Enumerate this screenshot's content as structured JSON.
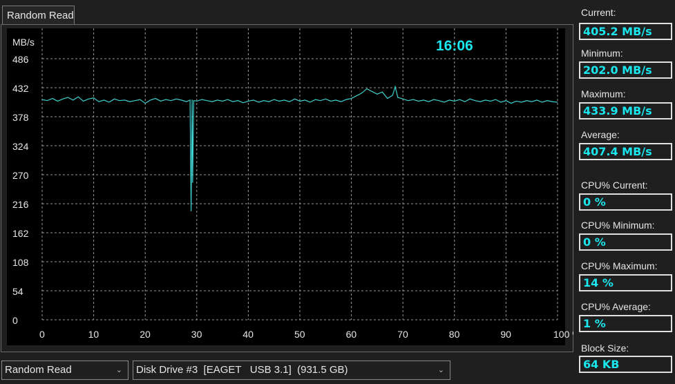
{
  "tab": {
    "label": "Random Read"
  },
  "clock": "16:06",
  "stats": [
    {
      "label": "Current:",
      "value": "405.2 MB/s"
    },
    {
      "label": "Minimum:",
      "value": "202.0 MB/s"
    },
    {
      "label": "Maximum:",
      "value": "433.9 MB/s"
    },
    {
      "label": "Average:",
      "value": "407.4 MB/s"
    },
    {
      "label": "CPU% Current:",
      "value": "0 %"
    },
    {
      "label": "CPU% Minimum:",
      "value": "0 %"
    },
    {
      "label": "CPU% Maximum:",
      "value": "14 %"
    },
    {
      "label": "CPU% Average:",
      "value": "1 %"
    },
    {
      "label": "Block Size:",
      "value": "64 KB"
    }
  ],
  "controls": {
    "test_select": "Random Read",
    "drive_select": "Disk Drive #3  [EAGET   USB 3.1]  (931.5 GB)"
  },
  "chart_data": {
    "type": "line",
    "ylabel": "MB/s",
    "xlabel": "%",
    "yticks": [
      "486",
      "432",
      "378",
      "324",
      "270",
      "216",
      "162",
      "108",
      "54",
      "0"
    ],
    "xticks": [
      "0",
      "10",
      "20",
      "30",
      "40",
      "50",
      "60",
      "70",
      "80",
      "90",
      "100 %"
    ],
    "ylim": [
      0,
      486
    ],
    "xlim": [
      0,
      100
    ],
    "color": "#40d0d0",
    "series": [
      {
        "name": "Random Read",
        "points": [
          [
            0,
            410
          ],
          [
            1,
            408
          ],
          [
            2,
            412
          ],
          [
            3,
            407
          ],
          [
            4,
            411
          ],
          [
            5,
            414
          ],
          [
            6,
            409
          ],
          [
            7,
            415
          ],
          [
            8,
            407
          ],
          [
            9,
            411
          ],
          [
            10,
            413
          ],
          [
            11,
            406
          ],
          [
            12,
            409
          ],
          [
            13,
            405
          ],
          [
            14,
            411
          ],
          [
            15,
            408
          ],
          [
            16,
            409
          ],
          [
            17,
            406
          ],
          [
            18,
            408
          ],
          [
            19,
            410
          ],
          [
            20,
            403
          ],
          [
            21,
            409
          ],
          [
            22,
            412
          ],
          [
            23,
            407
          ],
          [
            24,
            410
          ],
          [
            25,
            408
          ],
          [
            26,
            411
          ],
          [
            27,
            409
          ],
          [
            28,
            406
          ],
          [
            28.7,
            409
          ],
          [
            28.9,
            202
          ],
          [
            29.1,
            410
          ],
          [
            29.2,
            255
          ],
          [
            29.4,
            408
          ],
          [
            30,
            407
          ],
          [
            31,
            410
          ],
          [
            32,
            408
          ],
          [
            33,
            406
          ],
          [
            34,
            409
          ],
          [
            35,
            407
          ],
          [
            36,
            410
          ],
          [
            37,
            406
          ],
          [
            38,
            408
          ],
          [
            39,
            404
          ],
          [
            40,
            407
          ],
          [
            41,
            409
          ],
          [
            42,
            405
          ],
          [
            43,
            408
          ],
          [
            44,
            406
          ],
          [
            45,
            410
          ],
          [
            46,
            407
          ],
          [
            47,
            409
          ],
          [
            48,
            406
          ],
          [
            49,
            411
          ],
          [
            50,
            407
          ],
          [
            51,
            409
          ],
          [
            52,
            405
          ],
          [
            53,
            410
          ],
          [
            54,
            408
          ],
          [
            55,
            411
          ],
          [
            56,
            407
          ],
          [
            57,
            409
          ],
          [
            58,
            406
          ],
          [
            59,
            410
          ],
          [
            60,
            412
          ],
          [
            61,
            417
          ],
          [
            62,
            422
          ],
          [
            63,
            430
          ],
          [
            64,
            425
          ],
          [
            65,
            420
          ],
          [
            66,
            424
          ],
          [
            67,
            412
          ],
          [
            68,
            418
          ],
          [
            68.5,
            434
          ],
          [
            69,
            414
          ],
          [
            70,
            411
          ],
          [
            71,
            408
          ],
          [
            72,
            410
          ],
          [
            73,
            407
          ],
          [
            74,
            409
          ],
          [
            75,
            406
          ],
          [
            76,
            410
          ],
          [
            77,
            408
          ],
          [
            78,
            405
          ],
          [
            79,
            409
          ],
          [
            80,
            407
          ],
          [
            81,
            410
          ],
          [
            82,
            406
          ],
          [
            83,
            411
          ],
          [
            84,
            408
          ],
          [
            85,
            406
          ],
          [
            86,
            409
          ],
          [
            87,
            407
          ],
          [
            88,
            410
          ],
          [
            89,
            405
          ],
          [
            90,
            408
          ],
          [
            91,
            403
          ],
          [
            92,
            407
          ],
          [
            93,
            405
          ],
          [
            94,
            408
          ],
          [
            95,
            406
          ],
          [
            96,
            409
          ],
          [
            97,
            405
          ],
          [
            98,
            408
          ],
          [
            99,
            406
          ],
          [
            100,
            405
          ]
        ]
      }
    ]
  }
}
